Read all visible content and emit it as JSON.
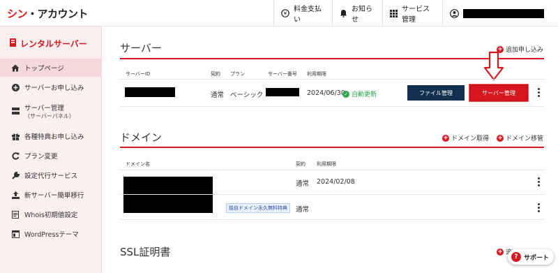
{
  "header": {
    "logo_part1": "シン",
    "logo_part2": "・アカウント",
    "fees_label": "料金支払い",
    "news_label": "お知らせ",
    "services_label": "サービス管理"
  },
  "sidebar": {
    "title": "レンタルサーバー",
    "items": [
      {
        "label": "トップページ"
      },
      {
        "label": "サーバーお申し込み"
      },
      {
        "label": "サーバー管理",
        "sub": "（サーバーパネル）"
      },
      {
        "label": "各種特典お申し込み"
      },
      {
        "label": "プラン変更"
      },
      {
        "label": "設定代行サービス"
      },
      {
        "label": "新サーバー簡単移行"
      },
      {
        "label": "Whois初期値設定"
      },
      {
        "label": "WordPressテーマ"
      }
    ]
  },
  "server": {
    "title": "サーバー",
    "add_link": "追加申し込み",
    "columns": {
      "id": "サーバーID",
      "contract": "契約",
      "plan": "プラン",
      "number": "サーバー番号",
      "expiry": "利用期限"
    },
    "row": {
      "contract": "通常",
      "plan": "ベーシック",
      "expiry": "2024/06/30",
      "auto_renew": "自動更新"
    },
    "file_button": "ファイル管理",
    "server_button": "サーバー管理"
  },
  "domain": {
    "title": "ドメイン",
    "acquire_link": "ドメイン取得",
    "transfer_link": "ドメイン移管",
    "columns": {
      "name": "ドメイン名",
      "contract": "契約",
      "expiry": "利用期限"
    },
    "rows": [
      {
        "contract": "通常",
        "expiry": "2024/02/08"
      },
      {
        "contract": "通常",
        "badge": "独自ドメイン永久無料特典"
      }
    ]
  },
  "ssl": {
    "title": "SSL証明書",
    "add_link": "追"
  },
  "support_label": "サポート",
  "colors": {
    "accent": "#d7171f",
    "navy": "#13304f",
    "sidebar_bg": "#fbeff0",
    "success": "#2aa84a"
  }
}
